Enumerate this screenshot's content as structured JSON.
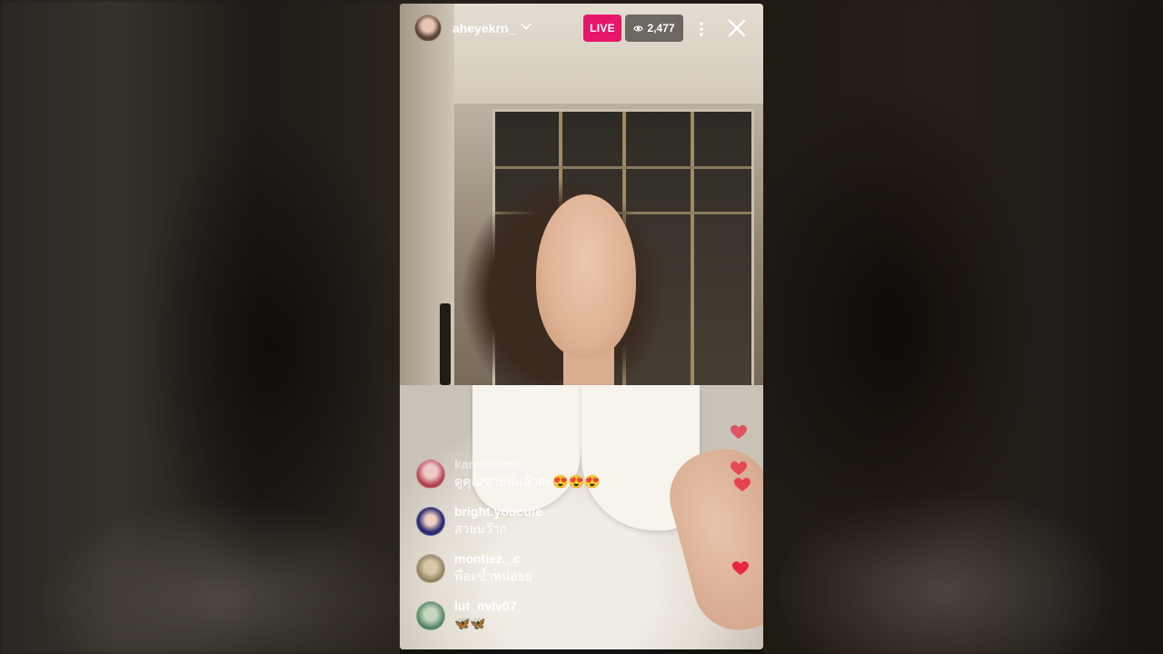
{
  "header": {
    "host_username": "aheyekrn_",
    "live_label": "LIVE",
    "viewer_count": "2,477"
  },
  "comments": [
    {
      "username": "kammmmic_",
      "text": "ดูคุณชายน์แล้วฮะ😍😍😍",
      "faded": true
    },
    {
      "username": "bright.youcute",
      "text": "สวยมว๊าก",
      "faded": false
    },
    {
      "username": "montiez._c",
      "text": "พี่อะข้ำหน่อยย",
      "faded": false
    },
    {
      "username": "lut_nvlv07",
      "text": "🦋🦋",
      "faded": false
    }
  ],
  "colors": {
    "live_badge": "#e6166b",
    "heart": "#e8283c"
  }
}
